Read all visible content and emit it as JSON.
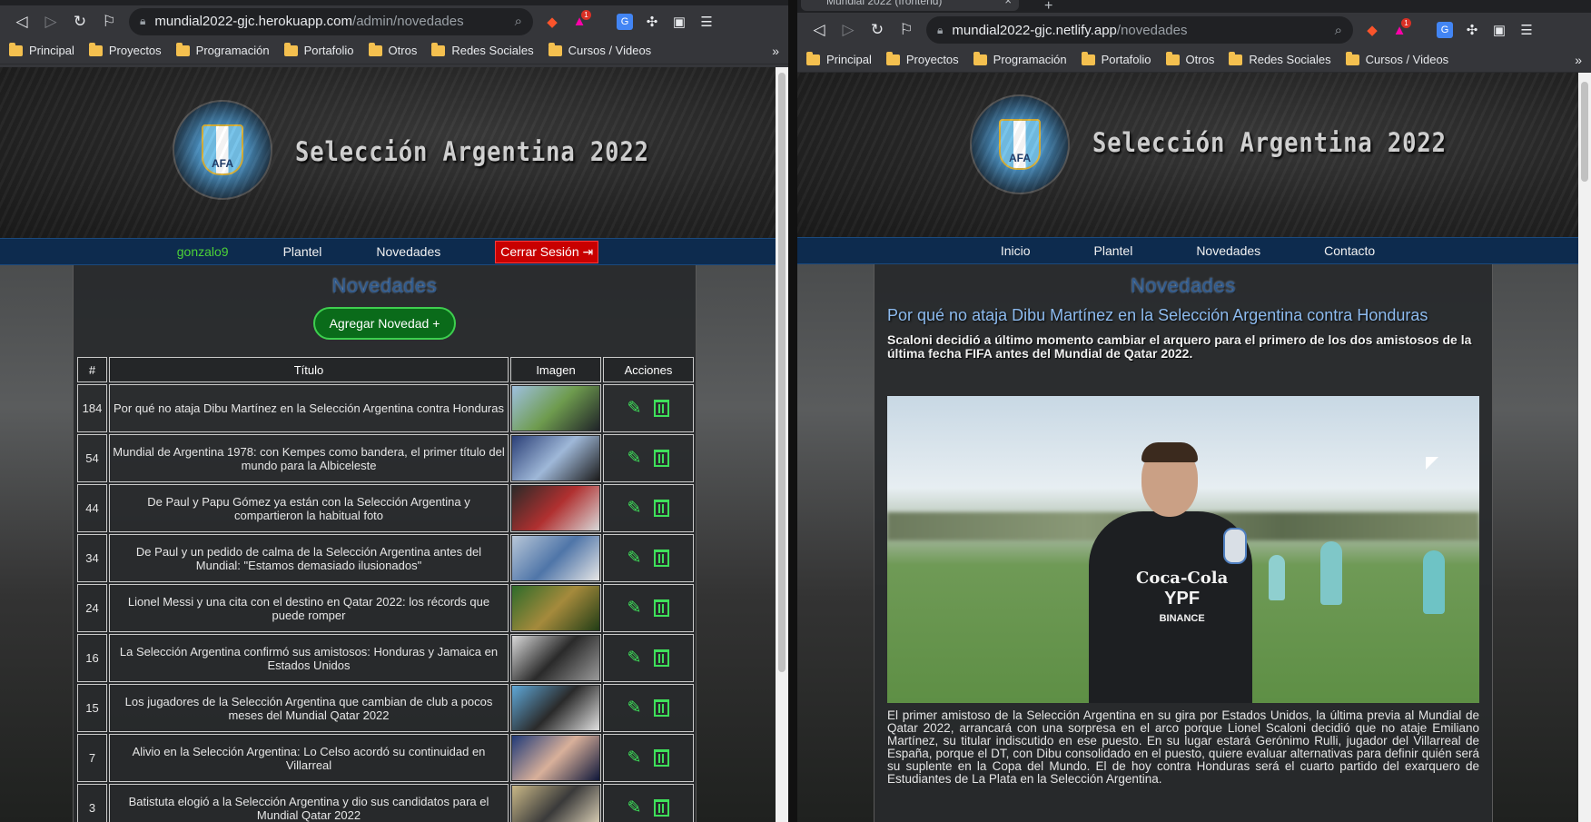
{
  "left_window": {
    "url_host": "mundial2022-gjc.herokuapp.com",
    "url_path": "/admin/novedades",
    "bookmarks": [
      "Principal",
      "Proyectos",
      "Programación",
      "Portafolio",
      "Otros",
      "Redes Sociales",
      "Cursos / Videos"
    ],
    "bookmarks_more": "»",
    "ext_badge": "1",
    "site_title": "Selección Argentina 2022",
    "logo_text": "AFA",
    "nav": {
      "user": "gonzalo9",
      "plantel": "Plantel",
      "novedades": "Novedades",
      "logout": "Cerrar Sesión"
    },
    "section_title": "Novedades",
    "add_button": "Agregar Novedad",
    "table_headers": [
      "#",
      "Título",
      "Imagen",
      "Acciones"
    ],
    "rows": [
      {
        "id": "184",
        "title": "Por qué no ataja Dibu Martínez en la Selección Argentina contra Honduras"
      },
      {
        "id": "54",
        "title": "Mundial de Argentina 1978: con Kempes como bandera, el primer título del mundo para la Albiceleste"
      },
      {
        "id": "44",
        "title": "De Paul y Papu Gómez ya están con la Selección Argentina y compartieron la habitual foto"
      },
      {
        "id": "34",
        "title": "De Paul y un pedido de calma de la Selección Argentina antes del Mundial: \"Estamos demasiado ilusionados\""
      },
      {
        "id": "24",
        "title": "Lionel Messi y una cita con el destino en Qatar 2022: los récords que puede romper"
      },
      {
        "id": "16",
        "title": "La Selección Argentina confirmó sus amistosos: Honduras y Jamaica en Estados Unidos"
      },
      {
        "id": "15",
        "title": "Los jugadores de la Selección Argentina que cambian de club a pocos meses del Mundial Qatar 2022"
      },
      {
        "id": "7",
        "title": "Alivio en la Selección Argentina: Lo Celso acordó su continuidad en Villarreal"
      },
      {
        "id": "3",
        "title": "Batistuta elogió a la Selección Argentina y dio sus candidatos para el Mundial Qatar 2022"
      }
    ]
  },
  "right_window": {
    "tab_title": "Mundial 2022 (frontend)",
    "tab_close": "×",
    "new_tab": "+",
    "url_host": "mundial2022-gjc.netlify.app",
    "url_path": "/novedades",
    "bookmarks": [
      "Principal",
      "Proyectos",
      "Programación",
      "Portafolio",
      "Otros",
      "Redes Sociales",
      "Cursos / Videos"
    ],
    "bookmarks_more": "»",
    "ext_badge": "1",
    "site_title": "Selección Argentina 2022",
    "logo_text": "AFA",
    "nav": [
      "Inicio",
      "Plantel",
      "Novedades",
      "Contacto"
    ],
    "section_title": "Novedades",
    "article": {
      "title": "Por qué no ataja Dibu Martínez en la Selección Argentina contra Honduras",
      "subtitle": "Scaloni decidió a último momento cambiar el arquero para el primero de los dos amistosos de la última fecha FIFA antes del Mundial de Qatar 2022.",
      "photo_text_1": "Coca-Cola",
      "photo_text_2": "YPF",
      "photo_text_3": "BINANCE",
      "body": "El primer amistoso de la Selección Argentina en su gira por Estados Unidos, la última previa al Mundial de Qatar 2022, arrancará con una sorpresa en el arco porque Lionel Scaloni decidió que no ataje Emiliano Martínez, su titular indiscutido en ese puesto. En su lugar estará Gerónimo Rulli, jugador del Villarreal de España, porque el DT, con Dibu consolidado en el puesto, quiere evaluar alternativas para definir quién será su suplente en la Copa del Mundo. El de hoy contra Honduras será el cuarto partido del exarquero de Estudiantes de La Plata en la Selección Argentina."
    }
  },
  "colors": {
    "nav_bg": "#0d2b4e",
    "logout_bg": "#c80000",
    "add_btn_bg": "#0a6b1a",
    "action_green": "#3ee05a",
    "user_green": "#4cd137",
    "article_title": "#8dbbef"
  },
  "icons": [
    "back-icon",
    "forward-icon",
    "reload-icon",
    "bookmark-icon",
    "lock-icon",
    "zoom-icon",
    "brave-icon",
    "brave-rewards-icon",
    "translate-icon",
    "extensions-icon",
    "wallet-icon",
    "menu-icon",
    "folder-icon",
    "pencil-icon",
    "trash-icon",
    "plus-icon",
    "logout-icon"
  ]
}
